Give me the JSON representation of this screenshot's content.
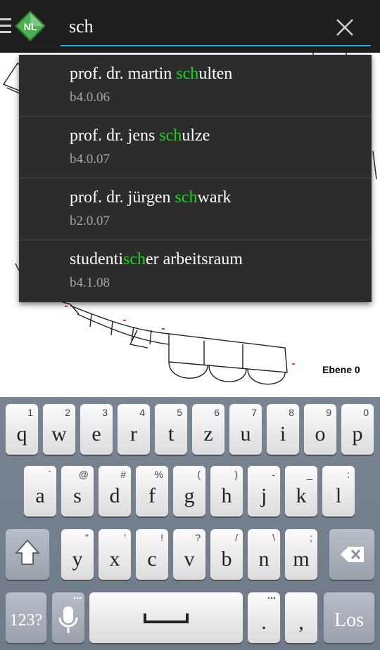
{
  "search": {
    "value": "sch"
  },
  "suggestions": [
    {
      "pre": "prof. dr. martin ",
      "match": "sch",
      "post": "ulten",
      "room": "b4.0.06"
    },
    {
      "pre": "prof. dr. jens ",
      "match": "sch",
      "post": "ulze",
      "room": "b4.0.07"
    },
    {
      "pre": "prof. dr. jürgen ",
      "match": "sch",
      "post": "wark",
      "room": "b2.0.07"
    },
    {
      "pre": "studenti",
      "match": "sch",
      "post": "er arbeitsraum",
      "room": "b4.1.08"
    }
  ],
  "map": {
    "level_label": "Ebene 0"
  },
  "keyboard": {
    "row1": [
      {
        "k": "q",
        "s": "1"
      },
      {
        "k": "w",
        "s": "2"
      },
      {
        "k": "e",
        "s": "3"
      },
      {
        "k": "r",
        "s": "4"
      },
      {
        "k": "t",
        "s": "5"
      },
      {
        "k": "z",
        "s": "6"
      },
      {
        "k": "u",
        "s": "7"
      },
      {
        "k": "i",
        "s": "8"
      },
      {
        "k": "o",
        "s": "9"
      },
      {
        "k": "p",
        "s": "0"
      }
    ],
    "row2": [
      {
        "k": "a",
        "s": "`"
      },
      {
        "k": "s",
        "s": "@"
      },
      {
        "k": "d",
        "s": "#"
      },
      {
        "k": "f",
        "s": "%"
      },
      {
        "k": "g",
        "s": "("
      },
      {
        "k": "h",
        "s": ")"
      },
      {
        "k": "j",
        "s": "-"
      },
      {
        "k": "k",
        "s": "_"
      },
      {
        "k": "l",
        "s": ":"
      }
    ],
    "row3": [
      {
        "k": "y",
        "s": "\""
      },
      {
        "k": "x",
        "s": "'"
      },
      {
        "k": "c",
        "s": "!"
      },
      {
        "k": "v",
        "s": "?"
      },
      {
        "k": "b",
        "s": "/"
      },
      {
        "k": "n",
        "s": "\\"
      },
      {
        "k": "m",
        "s": ";"
      }
    ],
    "numbers_label": "123?",
    "period": ".",
    "comma": ",",
    "go_label": "Los"
  },
  "colors": {
    "accent": "#2aa6cf",
    "highlight": "#1ed61e",
    "logo": "#43a047"
  }
}
